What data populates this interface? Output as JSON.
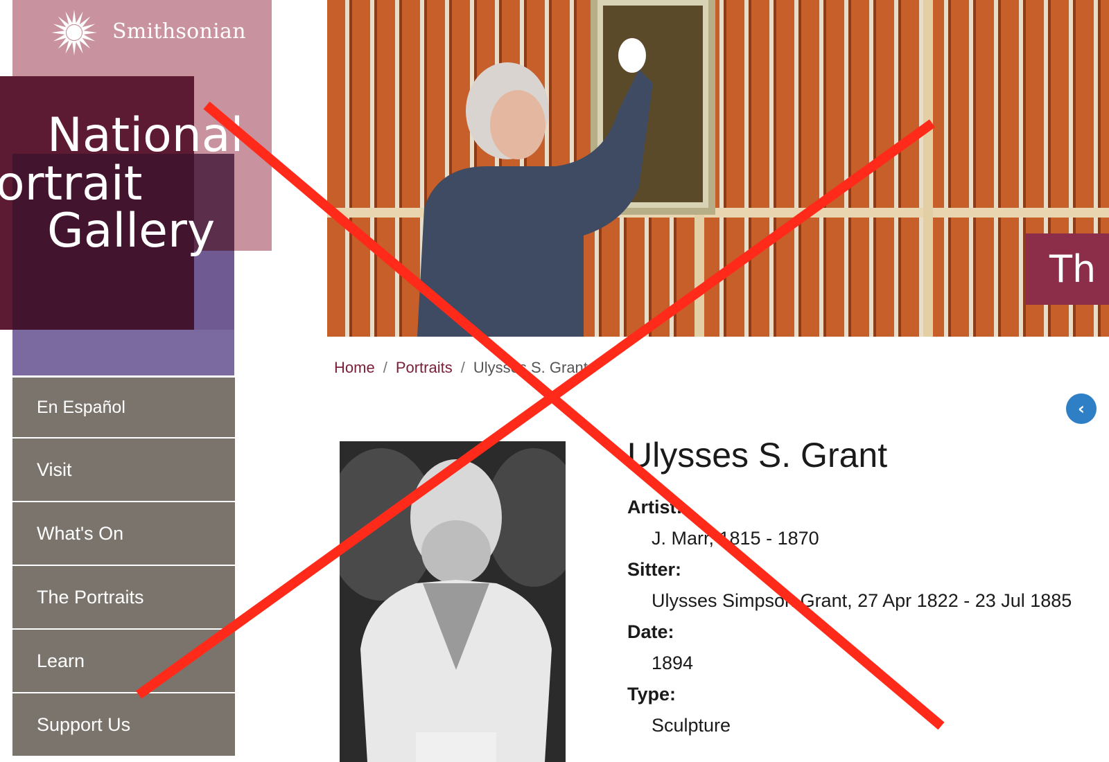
{
  "header": {
    "smithsonian_label": "Smithsonian",
    "logo_lines": [
      "National",
      "ortrait",
      "Gallery"
    ]
  },
  "nav": {
    "items": [
      {
        "label": "En Español"
      },
      {
        "label": "Visit"
      },
      {
        "label": "What's On"
      },
      {
        "label": "The Portraits"
      },
      {
        "label": "Learn"
      },
      {
        "label": "Support Us"
      }
    ]
  },
  "hero": {
    "badge_text": "Th"
  },
  "breadcrumb": {
    "home": "Home",
    "portraits": "Portraits",
    "current": "Ulysses S. Grant",
    "separator": "/"
  },
  "object": {
    "title": "Ulysses S. Grant",
    "fields": [
      {
        "label": "Artist:",
        "value": "J. Marr, 1815 - 1870"
      },
      {
        "label": "Sitter:",
        "value": "Ulysses Simpson Grant, 27 Apr 1822 - 23 Jul 1885"
      },
      {
        "label": "Date:",
        "value": "1894"
      },
      {
        "label": "Type:",
        "value": "Sculpture"
      }
    ]
  },
  "colors": {
    "nav_bg": "#7b746c",
    "link": "#7a1d36",
    "cross": "#ff2a1a"
  }
}
